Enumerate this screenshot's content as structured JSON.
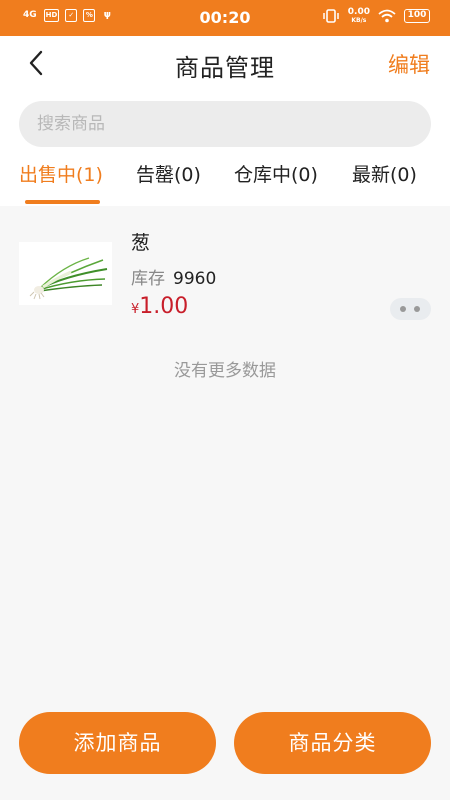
{
  "status_bar": {
    "time": "00:20",
    "left_icons": [
      "4G",
      "HD",
      "✓",
      "%",
      "ψ"
    ],
    "net_speed": "0.00",
    "net_speed_unit": "KB/s",
    "battery": "100"
  },
  "nav": {
    "title": "商品管理",
    "edit_label": "编辑"
  },
  "search": {
    "placeholder": "搜索商品",
    "value": ""
  },
  "tabs": [
    {
      "label": "出售中(1)",
      "active": true
    },
    {
      "label": "告罄(0)",
      "active": false
    },
    {
      "label": "仓库中(0)",
      "active": false
    },
    {
      "label": "最新(0)",
      "active": false
    }
  ],
  "products": [
    {
      "name": "葱",
      "stock_label": "库存",
      "stock_value": "9960",
      "currency": "¥",
      "price": "1.00"
    }
  ],
  "list_end_text": "没有更多数据",
  "actions": {
    "add_label": "添加商品",
    "category_label": "商品分类"
  },
  "colors": {
    "accent": "#f07d1e",
    "price": "#c81e2a"
  }
}
